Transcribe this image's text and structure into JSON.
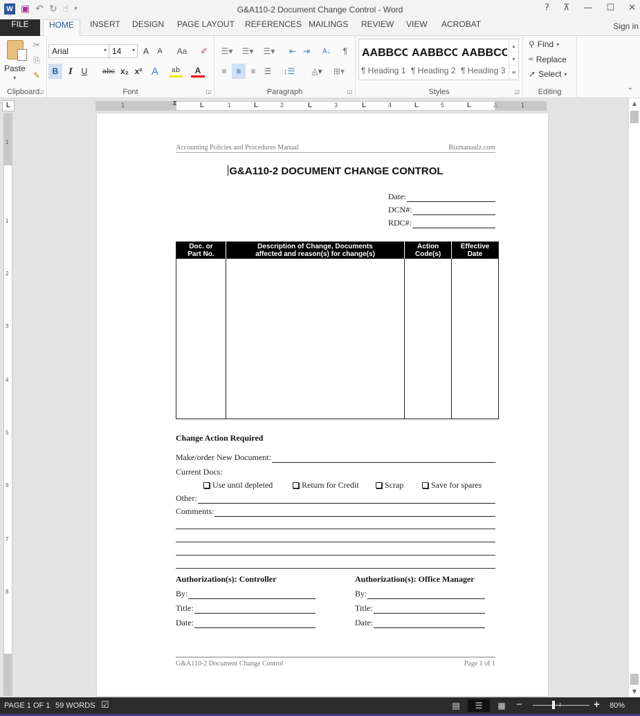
{
  "window": {
    "title": "G&A110-2 Document Change Control - Word",
    "controls": {
      "help": "?",
      "ribbon_display": "⊼",
      "minimize": "—",
      "maximize": "☐",
      "close": "✕"
    }
  },
  "qat": {
    "app_icon": "W",
    "save_icon": "save-icon",
    "undo_icon": "undo-icon",
    "redo_icon": "redo-icon",
    "touch_icon": "touch-mode-icon",
    "customize_icon": "customize-icon"
  },
  "tabs": [
    {
      "label": "FILE"
    },
    {
      "label": "HOME",
      "active": true
    },
    {
      "label": "INSERT"
    },
    {
      "label": "DESIGN"
    },
    {
      "label": "PAGE LAYOUT"
    },
    {
      "label": "REFERENCES"
    },
    {
      "label": "MAILINGS"
    },
    {
      "label": "REVIEW"
    },
    {
      "label": "VIEW"
    },
    {
      "label": "ACROBAT"
    }
  ],
  "signin": "Sign in",
  "ribbon": {
    "clipboard": {
      "label": "Clipboard",
      "paste": "Paste"
    },
    "font": {
      "label": "Font",
      "family": "Arial",
      "size": "14",
      "grow": "A",
      "shrink": "A",
      "case": "Aa",
      "bold": "B",
      "italic": "I",
      "underline": "U",
      "strike": "abc",
      "subscript": "x₂",
      "superscript": "x²",
      "effects": "A",
      "highlight": "ab",
      "color": "A"
    },
    "paragraph": {
      "label": "Paragraph",
      "show_marks": "¶",
      "sort": "A↓"
    },
    "styles": {
      "label": "Styles",
      "items": [
        {
          "sample": "AABBCC",
          "name": "¶ Heading 1"
        },
        {
          "sample": "AABBCC",
          "name": "¶ Heading 2"
        },
        {
          "sample": "AABBCC",
          "name": "¶ Heading 3"
        }
      ]
    },
    "editing": {
      "label": "Editing",
      "find": "Find",
      "replace": "Replace",
      "select": "Select"
    }
  },
  "ruler": {
    "corner": "L",
    "h_numbers": [
      "1",
      "1",
      "2",
      "3",
      "4",
      "5",
      "1"
    ],
    "v_numbers": [
      "1",
      "1",
      "2",
      "3",
      "4",
      "5",
      "6",
      "7",
      "8"
    ]
  },
  "document": {
    "header_left": "Accounting Policies and Procedures Manual",
    "header_right": "Bizmanualz.com",
    "title": "G&A110-2 DOCUMENT CHANGE CONTROL",
    "meta_fields": [
      {
        "label": "Date:"
      },
      {
        "label": "DCN#:"
      },
      {
        "label": "RDC#:"
      }
    ],
    "table": {
      "headers": [
        [
          "Doc. or",
          "Part No."
        ],
        [
          "Description of Change, Documents",
          "affected and reason(s) for change(s)"
        ],
        [
          "Action",
          "Code(s)"
        ],
        [
          "Effective",
          "Date"
        ]
      ],
      "rows": [
        [
          "",
          "",
          "",
          ""
        ]
      ]
    },
    "section_heading": "Change Action Required",
    "make_order_label": "Make/order New Document:",
    "current_docs_label": "Current Docs:",
    "checkboxes": [
      {
        "label": "Use until depleted",
        "checked": false
      },
      {
        "label": "Return for Credit",
        "checked": false
      },
      {
        "label": "Scrap",
        "checked": false
      },
      {
        "label": "Save for spares",
        "checked": false
      }
    ],
    "other_label": "Other:",
    "comments_label": "Comments:",
    "auth_left": {
      "heading": "Authorization(s): Controller",
      "fields": [
        "By:",
        "Title:",
        "Date:"
      ]
    },
    "auth_right": {
      "heading": "Authorization(s): Office Manager",
      "fields": [
        "By:",
        "Title:",
        "Date:"
      ]
    },
    "footer_left": "G&A110-2 Document Change Control",
    "footer_right": "Page 1 of 1"
  },
  "statusbar": {
    "page": "PAGE 1 OF 1",
    "words": "59 WORDS",
    "proofing_icon": "proofing-icon",
    "views": [
      "read-mode",
      "print-layout",
      "web-layout"
    ],
    "active_view": "print-layout",
    "zoom_out": "−",
    "zoom_in": "+",
    "zoom_level": "80%",
    "zoom_percent": 80
  }
}
